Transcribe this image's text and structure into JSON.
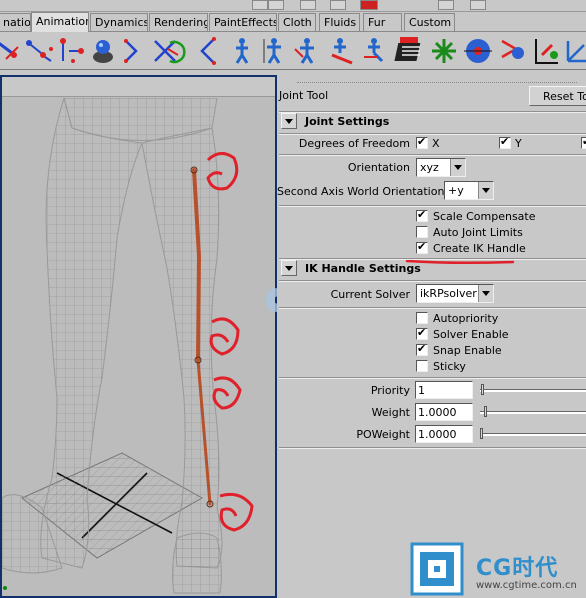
{
  "menu": {
    "tabs": [
      {
        "label": "nation"
      },
      {
        "label": "Animation"
      },
      {
        "label": "Dynamics"
      },
      {
        "label": "Rendering"
      },
      {
        "label": "PaintEffects"
      },
      {
        "label": "Cloth"
      },
      {
        "label": "Fluids"
      },
      {
        "label": "Fur"
      },
      {
        "label": "Custom"
      }
    ],
    "active_tab": "Animation"
  },
  "shelf": {
    "icons": [
      "ik-handle-icon",
      "ik-spline-icon",
      "joint-tool-icon",
      "insert-joint-icon",
      "mirror-joint-icon",
      "connect-joint-icon",
      "orient-joint-icon",
      "bend-curve-icon",
      "character-icon",
      "character-pose-icon",
      "skin-bind-icon",
      "rigid-bind-icon",
      "smooth-skin-icon",
      "paint-weights-icon",
      "cluster-icon",
      "lattice-icon",
      "wire-icon",
      "constraint-icon",
      "axis-icon"
    ]
  },
  "panel": {
    "tool_title": "Joint Tool",
    "reset_label": "Reset Tool",
    "joint_settings": {
      "title": "Joint Settings",
      "dof_label": "Degrees of Freedom",
      "dof_x": "X",
      "dof_y": "Y",
      "orientation_label": "Orientation",
      "orientation_value": "xyz",
      "second_axis_label": "Second Axis World Orientation",
      "second_axis_value": "+y",
      "scale_compensate": "Scale Compensate",
      "auto_joint_limits": "Auto Joint Limits",
      "create_ik_handle": "Create IK Handle"
    },
    "ik_settings": {
      "title": "IK Handle Settings",
      "solver_label": "Current Solver",
      "solver_value": "ikRPsolver",
      "autopriority": "Autopriority",
      "solver_enable": "Solver Enable",
      "snap_enable": "Snap Enable",
      "sticky": "Sticky",
      "priority_label": "Priority",
      "priority_value": "1",
      "weight_label": "Weight",
      "weight_value": "1.0000",
      "poweight_label": "POWeight",
      "poweight_value": "1.0000"
    }
  },
  "watermark": {
    "brand": "CG时代",
    "url": "www.cgtime.com.cn"
  },
  "colors": {
    "annotation_red": "#e0202a",
    "bone": "#b7512c",
    "viewport_border": "#12306a",
    "watermark_blue": "#2f8ecb"
  }
}
